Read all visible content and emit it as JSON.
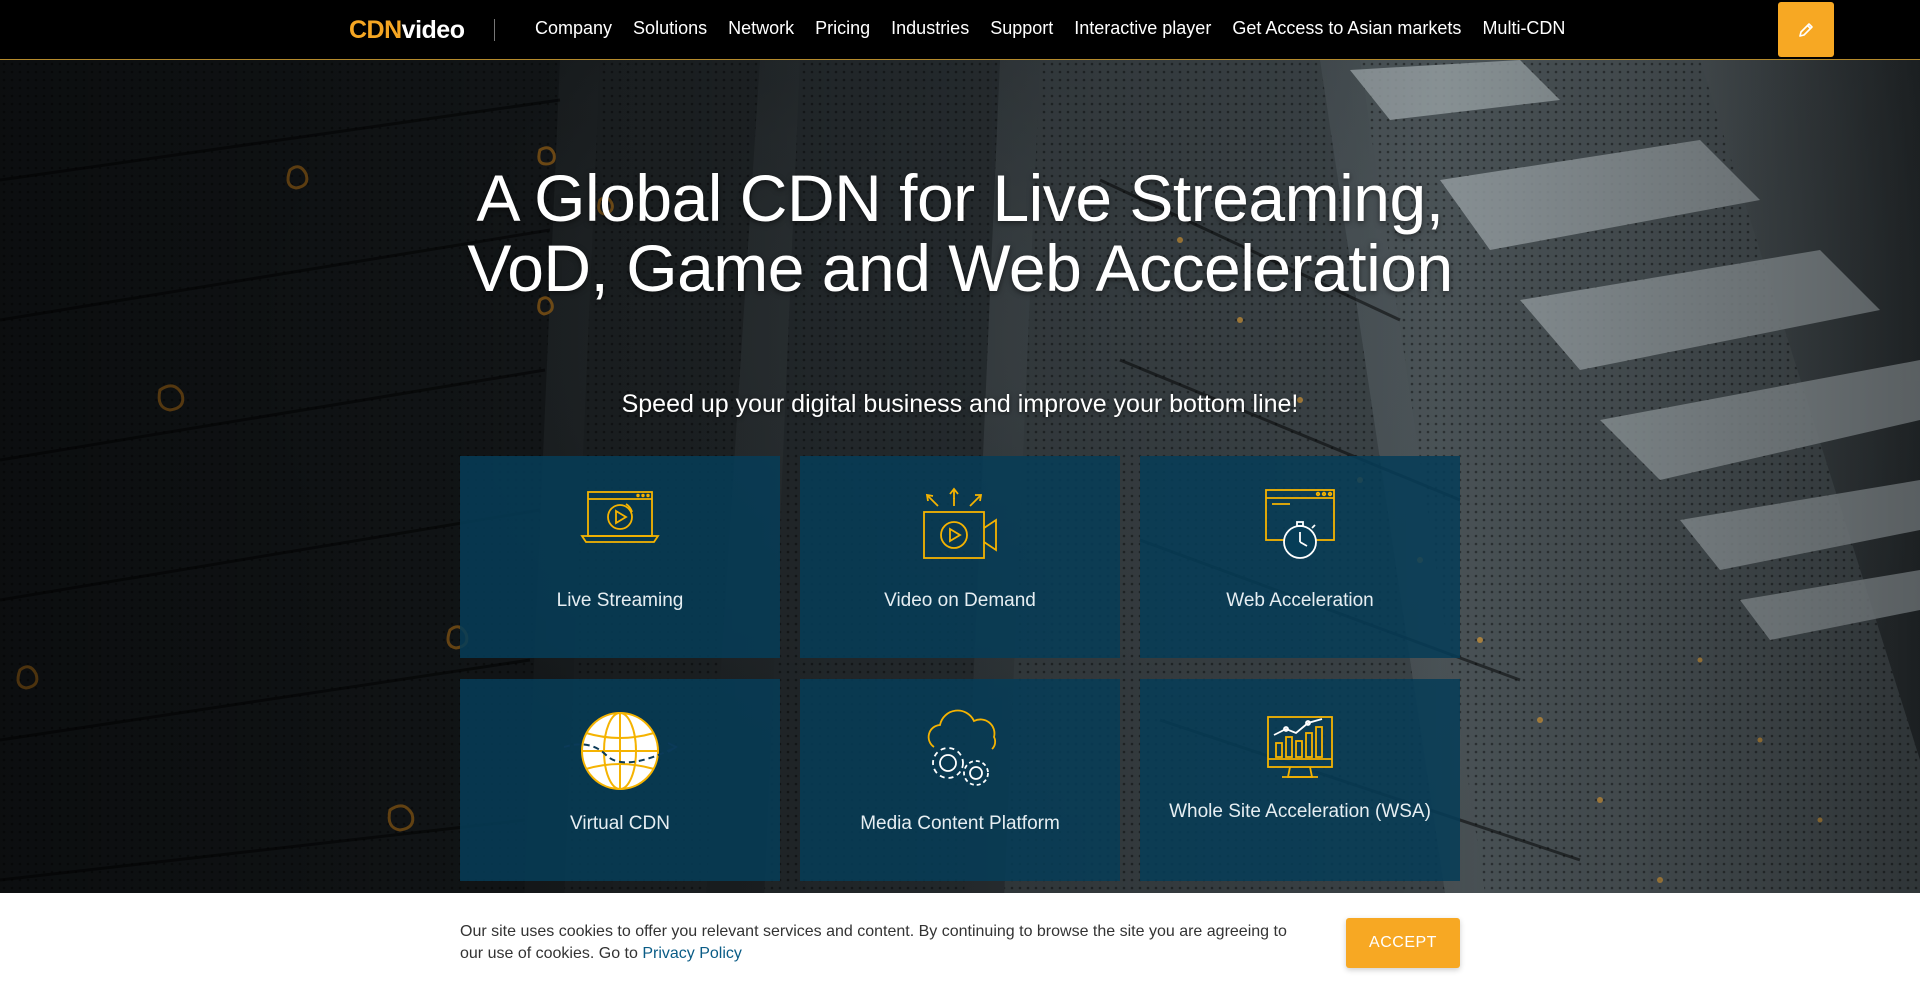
{
  "header": {
    "logo_mark": "CDN",
    "logo_word": "video",
    "nav": [
      {
        "label": "Company"
      },
      {
        "label": "Solutions"
      },
      {
        "label": "Network"
      },
      {
        "label": "Pricing"
      },
      {
        "label": "Industries"
      },
      {
        "label": "Support"
      },
      {
        "label": "Interactive player"
      },
      {
        "label": "Get Access to Asian markets"
      },
      {
        "label": "Multi-CDN"
      }
    ],
    "edit_icon": "pencil-icon"
  },
  "hero": {
    "title": "A Global CDN for Live Streaming, VoD, Game and Web Acceleration",
    "subtitle": "Speed up your digital business and improve your bottom line!"
  },
  "cards": [
    {
      "label": "Live Streaming",
      "icon": "live-streaming-icon"
    },
    {
      "label": "Video on Demand",
      "icon": "video-on-demand-icon"
    },
    {
      "label": "Web Acceleration",
      "icon": "web-acceleration-icon"
    },
    {
      "label": "Virtual CDN",
      "icon": "globe-icon"
    },
    {
      "label": "Media Content Platform",
      "icon": "cloud-gears-icon"
    },
    {
      "label": "Whole Site Acceleration (WSA)",
      "icon": "monitor-chart-icon"
    }
  ],
  "cookie": {
    "text": "Our site uses cookies to offer you relevant services and content. By continuing to browse the site you are agreeing to our use of cookies. Go to ",
    "link": "Privacy Policy",
    "accept": "ACCEPT"
  },
  "colors": {
    "accent": "#f7a823",
    "card_bg": "#063d57",
    "header_bg": "#000000",
    "link": "#0a5c86"
  }
}
